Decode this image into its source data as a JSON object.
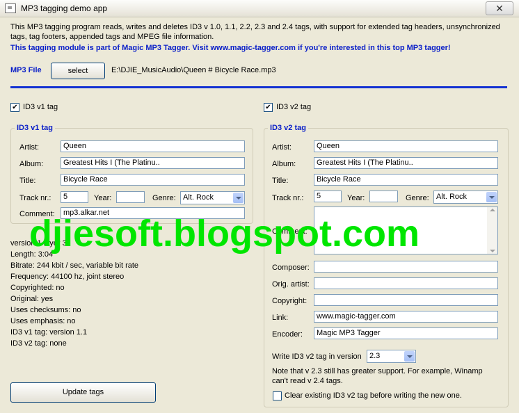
{
  "window": {
    "title": "MP3 tagging demo app",
    "close_glyph": "✕"
  },
  "description": "This MP3 tagging program reads, writes and deletes ID3 v 1.0, 1.1, 2.2, 2.3 and 2.4 tags, with support for extended tag headers, unsynchronized tags, tag footers, appended tags and MPEG file information.",
  "promo": "This tagging module is part of Magic MP3 Tagger. Visit www.magic-tagger.com if you're interested in this top MP3 tagger!",
  "file": {
    "label": "MP3 File",
    "select_label": "select",
    "path": "E:\\DJIE_MusicAudio\\Queen # Bicycle Race.mp3"
  },
  "v1": {
    "checkbox_label": "ID3 v1 tag",
    "checked": true,
    "group_title": "ID3 v1 tag",
    "artist_label": "Artist:",
    "artist": "Queen",
    "album_label": "Album:",
    "album": "Greatest Hits I (The Platinu..",
    "title_label": "Title:",
    "title": "Bicycle Race",
    "track_label": "Track nr.:",
    "track": "5",
    "year_label": "Year:",
    "year": "",
    "genre_label": "Genre:",
    "genre": "Alt. Rock",
    "comment_label": "Comment:",
    "comment": "mp3.alkar.net"
  },
  "v2": {
    "checkbox_label": "ID3 v2 tag",
    "checked": true,
    "group_title": "ID3 v2 tag",
    "artist_label": "Artist:",
    "artist": "Queen",
    "album_label": "Album:",
    "album": "Greatest Hits I (The Platinu..",
    "title_label": "Title:",
    "title": "Bicycle Race",
    "track_label": "Track nr.:",
    "track": "5",
    "year_label": "Year:",
    "year": "",
    "genre_label": "Genre:",
    "genre": "Alt. Rock",
    "comment_label": "Comment:",
    "comment": "",
    "composer_label": "Composer:",
    "composer": "",
    "orig_artist_label": "Orig. artist:",
    "orig_artist": "",
    "copyright_label": "Copyright:",
    "copyright": "",
    "link_label": "Link:",
    "link": "www.magic-tagger.com",
    "encoder_label": "Encoder:",
    "encoder": "Magic MP3 Tagger",
    "write_version_label": "Write ID3 v2 tag in version",
    "write_version": "2.3",
    "note": "Note that v 2.3 still has greater support. For example, Winamp can't read v 2.4 tags.",
    "clear_label": "Clear existing ID3 v2 tag before writing the new one.",
    "clear_checked": false
  },
  "info": [
    "version 1 layer 3",
    "Length: 3:04",
    "Bitrate: 244 kbit / sec, variable bit rate",
    "Frequency: 44100 hz, joint stereo",
    "Copyrighted: no",
    "Original: yes",
    "Uses checksums: no",
    "Uses emphasis: no",
    "ID3 v1 tag: version 1.1",
    "ID3 v2 tag: none"
  ],
  "update_label": "Update tags",
  "watermark": "djiesoft.blogspot.com",
  "colors": {
    "accent_blue": "#0a1fc8",
    "rule_blue": "#1432d2",
    "watermark_green": "#00e600",
    "window_bg": "#ece9d8"
  }
}
